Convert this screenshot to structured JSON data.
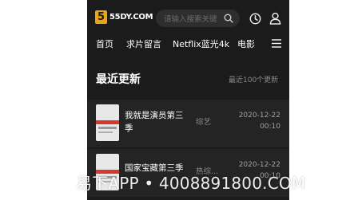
{
  "header": {
    "logo_badge": "5",
    "logo_text": "55DY.COM",
    "search_placeholder": "请输入搜索关键"
  },
  "nav": {
    "items": [
      {
        "label": "首页"
      },
      {
        "label": "求片留言"
      },
      {
        "label": "Netflix蓝光4k"
      },
      {
        "label": "电影"
      }
    ]
  },
  "section": {
    "title": "最近更新",
    "subtitle": "最近100个更新"
  },
  "list": [
    {
      "title": "我就是演员第三季",
      "category": "综艺",
      "date": "2020-12-22",
      "time": "00:10"
    },
    {
      "title": "国家宝藏第三季",
      "category": "热综...",
      "date": "2020-12-22",
      "time": "00:10"
    }
  ],
  "watermark": "易下APP • 4008891800.COM",
  "colors": {
    "background": "#1b1b1b",
    "logo_accent": "#e8a317",
    "text_primary": "#ffffff",
    "text_muted": "#8a8a8a"
  }
}
